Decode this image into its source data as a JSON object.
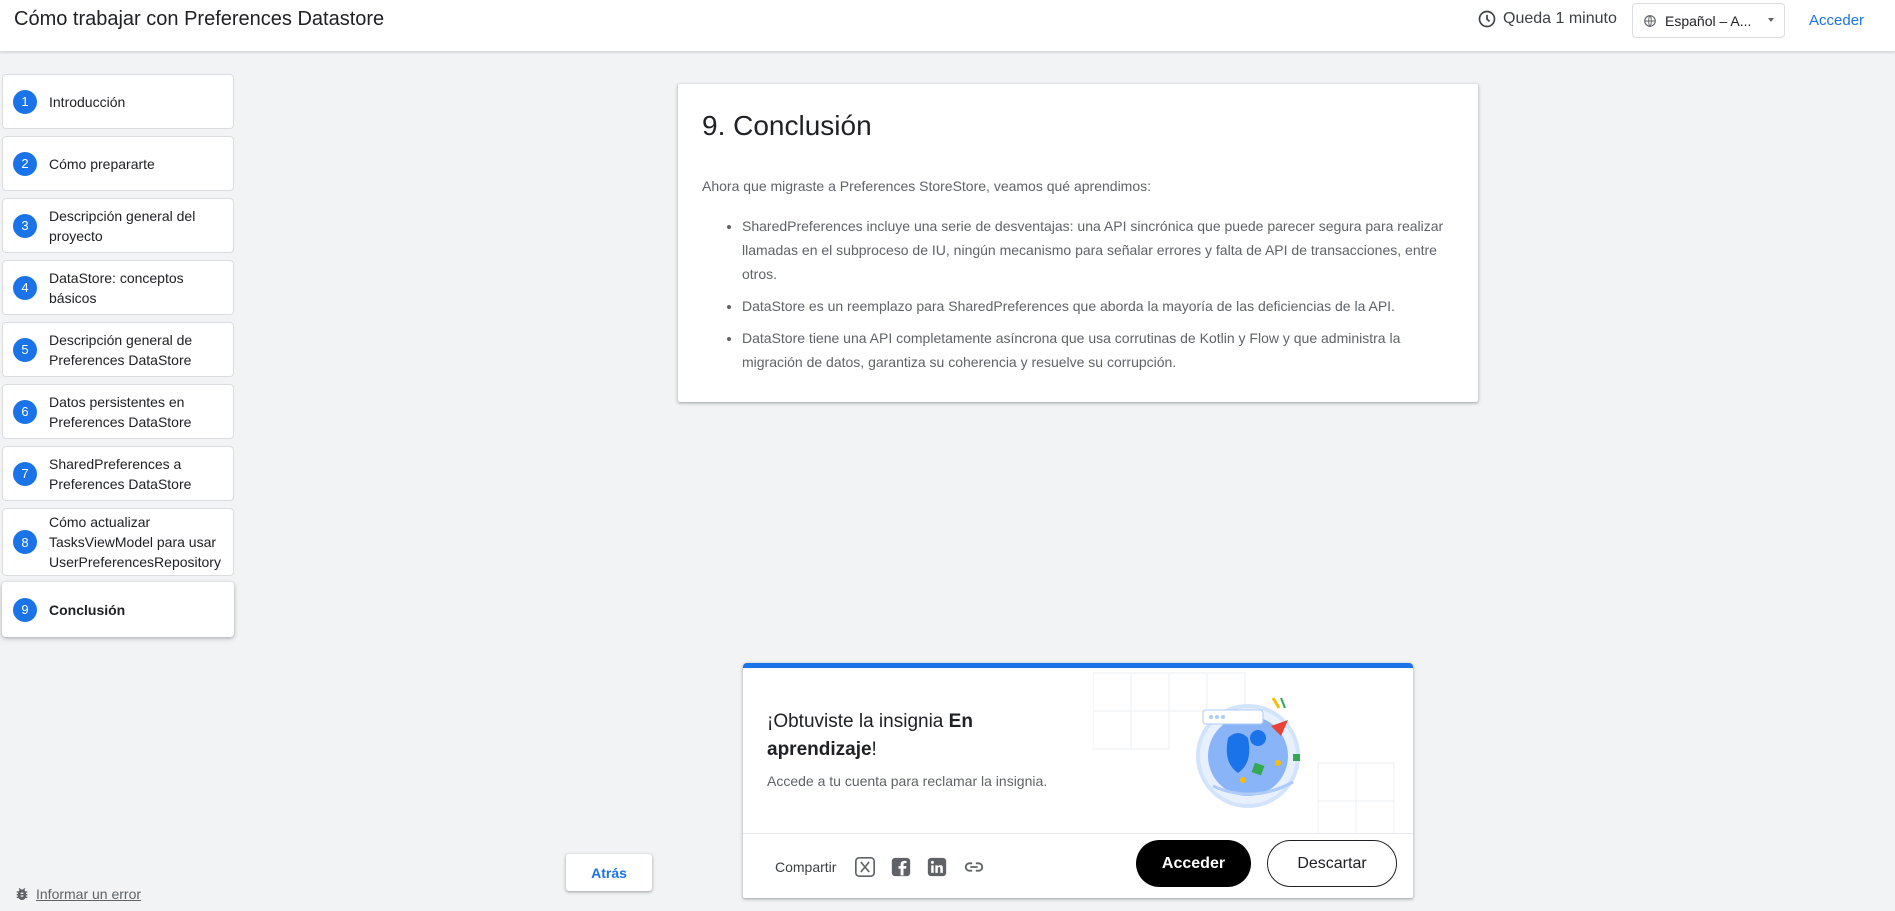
{
  "header": {
    "title": "Cómo trabajar con Preferences Datastore",
    "time_left": "Queda 1 minuto",
    "language": "Español – A...",
    "signin": "Acceder"
  },
  "steps": [
    {
      "num": "1",
      "label": "Introducción"
    },
    {
      "num": "2",
      "label": "Cómo prepararte"
    },
    {
      "num": "3",
      "label": "Descripción general del proyecto"
    },
    {
      "num": "4",
      "label": "DataStore: conceptos básicos"
    },
    {
      "num": "5",
      "label": "Descripción general de Preferences DataStore"
    },
    {
      "num": "6",
      "label": "Datos persistentes en Preferences DataStore"
    },
    {
      "num": "7",
      "label": "SharedPreferences a Preferences DataStore"
    },
    {
      "num": "8",
      "label": "Cómo actualizar TasksViewModel para usar UserPreferencesRepository"
    },
    {
      "num": "9",
      "label": "Conclusión"
    }
  ],
  "active_step": "9",
  "content": {
    "heading": "9. Conclusión",
    "intro": "Ahora que migraste a Preferences StoreStore, veamos qué aprendimos:",
    "bullets": [
      "SharedPreferences incluye una serie de desventajas: una API sincrónica que puede parecer segura para realizar llamadas en el subproceso de IU, ningún mecanismo para señalar errores y falta de API de transacciones, entre otros.",
      "DataStore es un reemplazo para SharedPreferences que aborda la mayoría de las deficiencias de la API.",
      "DataStore tiene una API completamente asíncrona que usa corrutinas de Kotlin y Flow y que administra la migración de datos, garantiza su coherencia y resuelve su corrupción."
    ]
  },
  "badge": {
    "heading_prefix": "¡Obtuviste la insignia ",
    "heading_bold": "En aprendizaje",
    "heading_suffix": "!",
    "subtitle": "Accede a tu cuenta para reclamar la insignia.",
    "share_label": "Compartir",
    "share_icons": [
      "x-icon",
      "facebook-icon",
      "linkedin-icon",
      "link-icon"
    ],
    "signin_button": "Acceder",
    "dismiss_button": "Descartar"
  },
  "back_button": "Atrás",
  "report_error": "Informar un error",
  "colors": {
    "accent": "#1a73e8",
    "background": "#f1f3f4"
  }
}
